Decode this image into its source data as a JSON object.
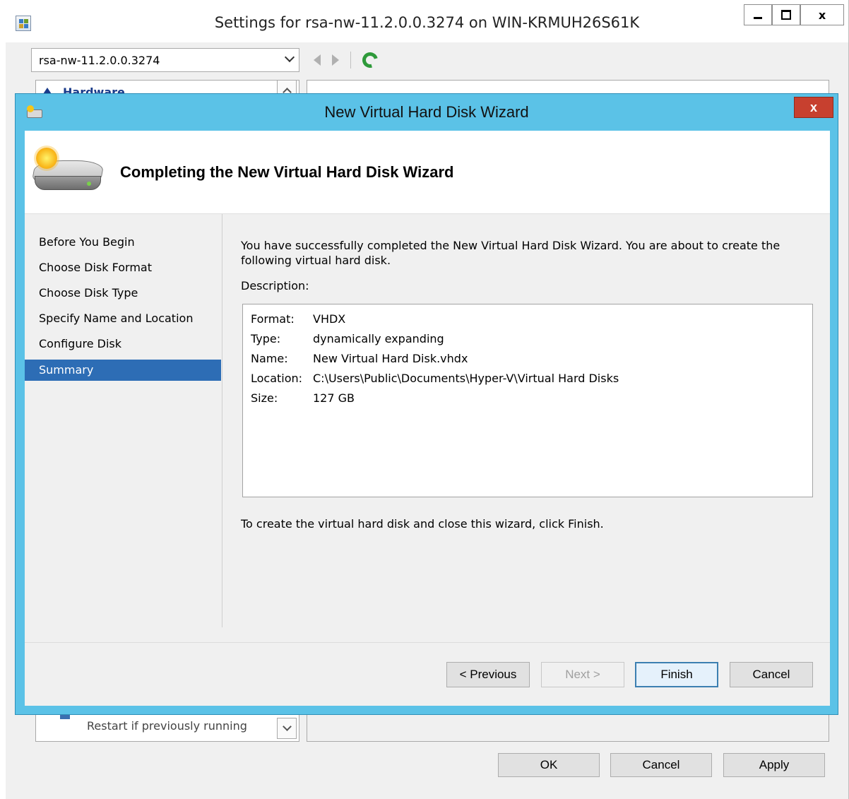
{
  "settings_window": {
    "title": "Settings for rsa-nw-11.2.0.0.3274 on WIN-KRMUH26S61K",
    "controls": {
      "close": "x"
    },
    "vm_selector": {
      "value": "rsa-nw-11.2.0.0.3274"
    },
    "hardware_tree": {
      "top_label": "Hardware",
      "bottom_label": "Restart if previously running"
    },
    "buttons": {
      "ok": "OK",
      "cancel": "Cancel",
      "apply": "Apply"
    }
  },
  "wizard": {
    "title": "New Virtual Hard Disk Wizard",
    "close": "x",
    "heading": "Completing the New Virtual Hard Disk Wizard",
    "steps": [
      {
        "label": "Before You Begin",
        "active": false
      },
      {
        "label": "Choose Disk Format",
        "active": false
      },
      {
        "label": "Choose Disk Type",
        "active": false
      },
      {
        "label": "Specify Name and Location",
        "active": false
      },
      {
        "label": "Configure Disk",
        "active": false
      },
      {
        "label": "Summary",
        "active": true
      }
    ],
    "intro": "You have successfully completed the New Virtual Hard Disk Wizard. You are about to create the following virtual hard disk.",
    "description_label": "Description:",
    "description": [
      {
        "key": "Format:",
        "value": "VHDX"
      },
      {
        "key": "Type:",
        "value": "dynamically expanding"
      },
      {
        "key": "Name:",
        "value": "New Virtual Hard Disk.vhdx"
      },
      {
        "key": "Location:",
        "value": "C:\\Users\\Public\\Documents\\Hyper-V\\Virtual Hard Disks"
      },
      {
        "key": "Size:",
        "value": "127 GB"
      }
    ],
    "outro": "To create the virtual hard disk and close this wizard, click Finish.",
    "buttons": {
      "previous": "< Previous",
      "next": "Next >",
      "finish": "Finish",
      "cancel": "Cancel"
    }
  },
  "colors": {
    "wizard_frame": "#5bc2e7",
    "selected_step": "#2d6db5",
    "close_button": "#c7402f"
  }
}
